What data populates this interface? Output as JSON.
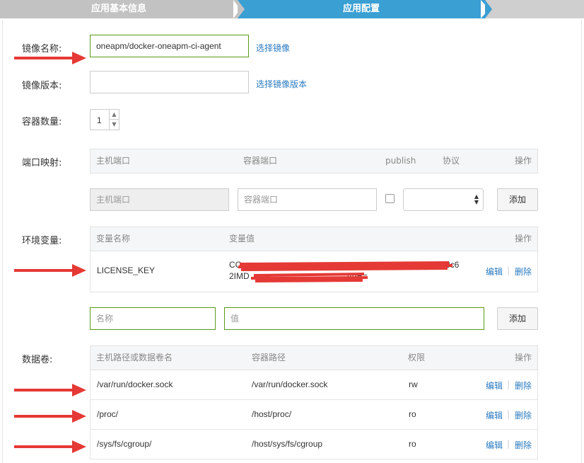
{
  "steps": [
    {
      "label": "应用基本信息"
    },
    {
      "label": "应用配置"
    }
  ],
  "form": {
    "image_name": {
      "label": "镜像名称:",
      "value": "oneapm/docker-oneapm-ci-agent",
      "link": "选择镜像"
    },
    "image_version": {
      "label": "镜像版本:",
      "value": "",
      "link": "选择镜像版本"
    },
    "container_count": {
      "label": "容器数量:",
      "value": "1"
    },
    "port_mapping": {
      "label": "端口映射:",
      "headers": [
        "主机端口",
        "容器端口",
        "publish",
        "协议",
        "操作"
      ],
      "host_port_placeholder": "主机端口",
      "container_port_placeholder": "容器端口",
      "publish_checked": false,
      "protocol_value": "",
      "add_label": "添加"
    },
    "env": {
      "label": "环境变量:",
      "headers": [
        "变量名称",
        "变量值",
        "操作"
      ],
      "rows": [
        {
          "name": "LICENSE_KEY",
          "value_line1": "CC",
          "value_line1_end": "3c6",
          "value_line2": "2IMD",
          "value_line2_end": "AgE="
        }
      ],
      "edit_label": "编辑",
      "delete_label": "删除",
      "name_placeholder": "名称",
      "value_placeholder": "值",
      "add_label": "添加"
    },
    "volumes": {
      "label": "数据卷:",
      "headers": [
        "主机路径或数据卷名",
        "容器路径",
        "权限",
        "操作"
      ],
      "rows": [
        {
          "host": "/var/run/docker.sock",
          "container": "/var/run/docker.sock",
          "perm": "rw"
        },
        {
          "host": "/proc/",
          "container": "/host/proc/",
          "perm": "ro"
        },
        {
          "host": "/sys/fs/cgroup/",
          "container": "/host/sys/fs/cgroup",
          "perm": "ro"
        }
      ],
      "edit_label": "编辑",
      "delete_label": "删除"
    }
  },
  "colors": {
    "accent": "#3a9fd3",
    "link": "#2b7bc0",
    "arrow": "#e53935",
    "valid_border": "#5a9a1a"
  }
}
